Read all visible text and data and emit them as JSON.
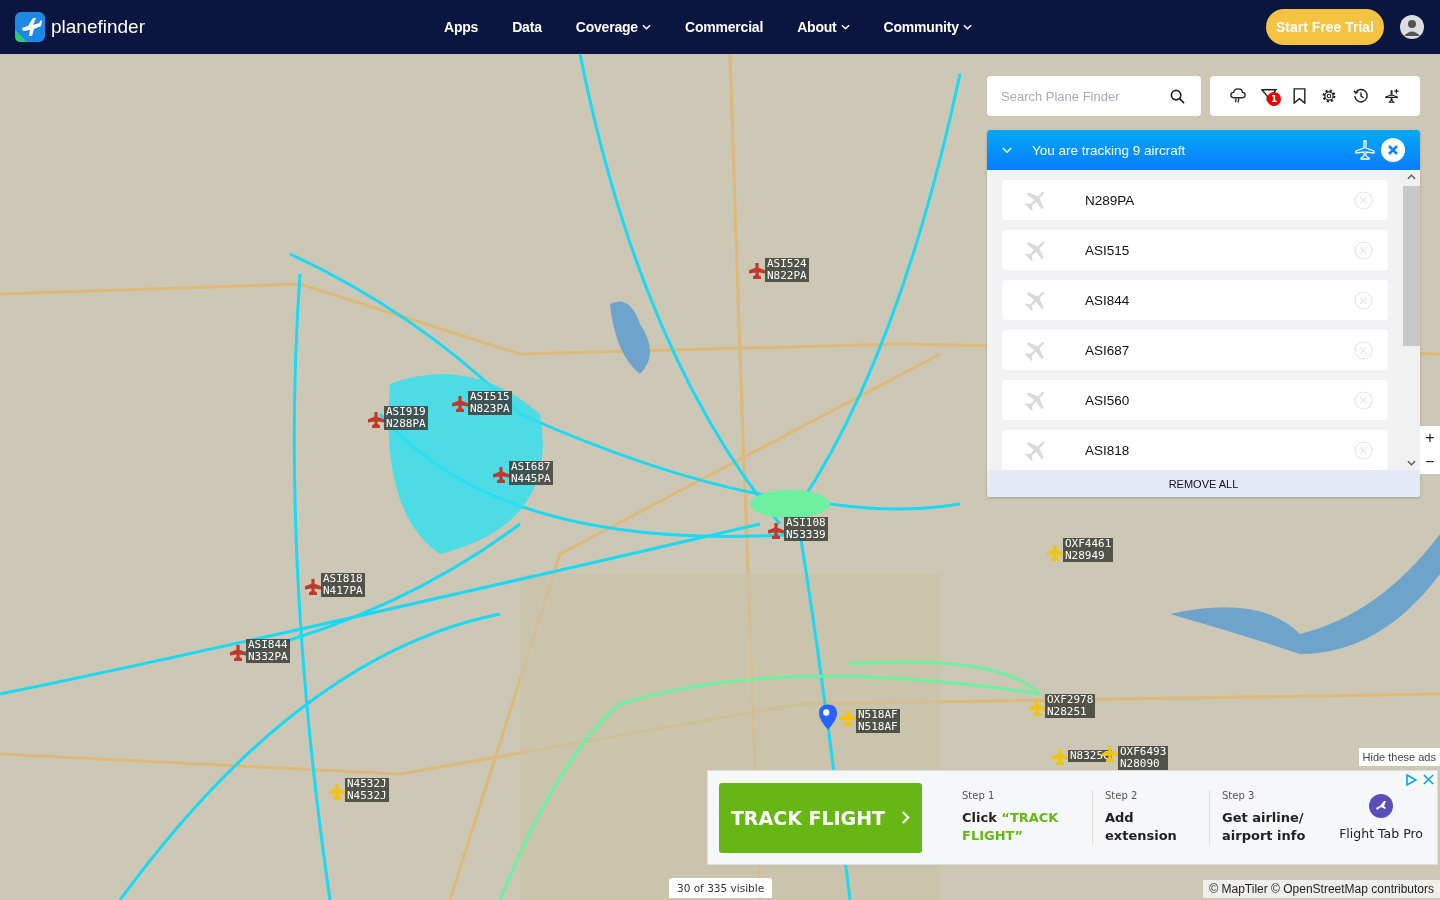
{
  "nav": {
    "brand": "planefinder",
    "links": [
      {
        "label": "Apps",
        "dropdown": false
      },
      {
        "label": "Data",
        "dropdown": false
      },
      {
        "label": "Coverage",
        "dropdown": true
      },
      {
        "label": "Commercial",
        "dropdown": false
      },
      {
        "label": "About",
        "dropdown": true
      },
      {
        "label": "Community",
        "dropdown": true
      }
    ],
    "cta": "Start Free Trial"
  },
  "search": {
    "placeholder": "Search Plane Finder"
  },
  "toolbar": {
    "filter_badge": "1"
  },
  "tracking": {
    "title": "You are tracking 9 aircraft",
    "expanded": true,
    "items": [
      {
        "label": "N289PA"
      },
      {
        "label": "ASI515"
      },
      {
        "label": "ASI844"
      },
      {
        "label": "ASI687"
      },
      {
        "label": "ASI560"
      },
      {
        "label": "ASI818"
      }
    ],
    "remove_all": "REMOVE ALL"
  },
  "map": {
    "aircraft": [
      {
        "callsign": "ASI524",
        "registration": "N822PA",
        "color": "#c0392b"
      },
      {
        "callsign": "ASI515",
        "registration": "N823PA",
        "color": "#c0392b"
      },
      {
        "callsign": "ASI919",
        "registration": "N288PA",
        "color": "#c0392b"
      },
      {
        "callsign": "ASI687",
        "registration": "N445PA",
        "color": "#c0392b"
      },
      {
        "callsign": "ASI108",
        "registration": "N53339",
        "color": "#c0392b"
      },
      {
        "callsign": "ASI818",
        "registration": "N417PA",
        "color": "#c0392b"
      },
      {
        "callsign": "ASI844",
        "registration": "N332PA",
        "color": "#c0392b"
      },
      {
        "callsign": "OXF4461",
        "registration": "N28949",
        "color": "#f1c40f"
      },
      {
        "callsign": "OXF2978",
        "registration": "N28251",
        "color": "#f1c40f"
      },
      {
        "callsign": "N518AF",
        "registration": "N518AF",
        "color": "#f1c40f"
      },
      {
        "callsign": "N4532J",
        "registration": "N4532J",
        "color": "#f1c40f"
      },
      {
        "callsign": "N8325C",
        "color": "#f1c40f"
      },
      {
        "callsign": "OXF6493",
        "registration": "N28090",
        "color": "#f1c40f"
      }
    ],
    "zoom_controls": [
      "+",
      "−"
    ],
    "hide_ads": "Hide these ads",
    "visible_count": "30 of 335 visible",
    "attribution": "© MapTiler © OpenStreetMap contributors"
  },
  "ad": {
    "button": "TRACK FLIGHT",
    "steps": [
      {
        "step": "Step 1",
        "text": "Click",
        "highlight": "“TRACK FLIGHT”"
      },
      {
        "step": "Step 2",
        "text": "Add extension"
      },
      {
        "step": "Step 3",
        "text": "Get airline/ airport info"
      }
    ],
    "brand": "Flight Tab Pro"
  }
}
